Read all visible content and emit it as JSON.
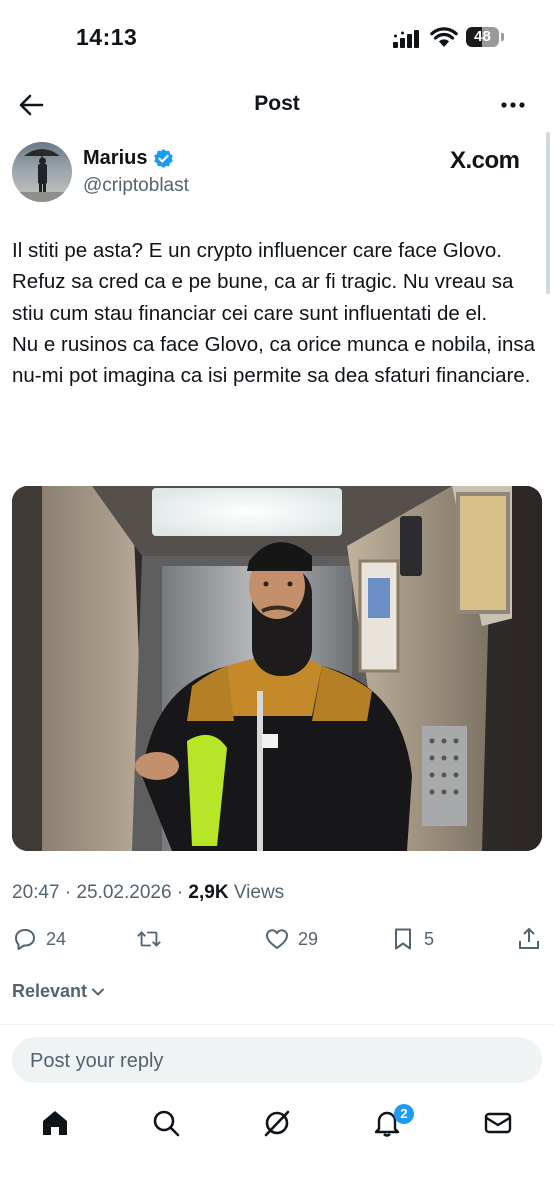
{
  "status_bar": {
    "time": "14:13",
    "battery": "48",
    "battery_level": 0.48
  },
  "header": {
    "title": "Post"
  },
  "author": {
    "name": "Marius",
    "handle": "@criptoblast",
    "source": "X.com"
  },
  "tweet": {
    "text": "Il stiti pe asta? E un crypto influencer care face Glovo. Refuz sa cred ca e pe bune, ca ar fi tragic. Nu vreau sa stiu cum stau financiar cei care sunt influentati de el.\nNu e rusinos ca face Glovo, ca orice munca e nobila, insa nu-mi pot imagina ca isi permite sa dea sfaturi financiare."
  },
  "meta": {
    "time": "20:47",
    "separator": " · ",
    "date": "25.02.2026",
    "views_count": "2,9K",
    "views_label": "Views"
  },
  "actions": {
    "replies": "24",
    "reposts": "",
    "likes": "29",
    "bookmarks": "5"
  },
  "sort": {
    "label": "Relevant"
  },
  "reply": {
    "placeholder": "Post your reply"
  },
  "tabbar": {
    "notifications_badge": "2"
  },
  "icons": {
    "back": "arrow-left-icon",
    "more": "more-icon",
    "verified": "verified-icon",
    "reply": "comment-icon",
    "repost": "repost-icon",
    "like": "heart-icon",
    "bookmark": "bookmark-icon",
    "share": "share-icon",
    "home": "home-icon",
    "search": "search-icon",
    "grok": "grok-icon",
    "notifications": "bell-icon",
    "messages": "mail-icon"
  },
  "colors": {
    "accent": "#1d9bf0",
    "text": "#0f1419",
    "secondary": "#536471"
  }
}
